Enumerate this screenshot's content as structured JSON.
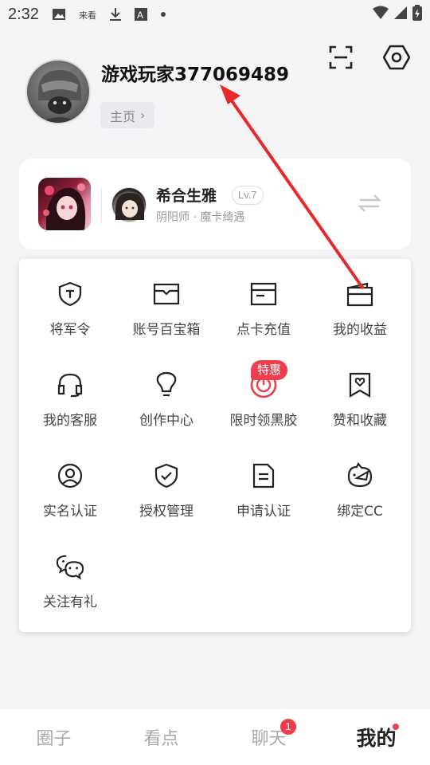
{
  "status_bar": {
    "time": "2:32",
    "icons": [
      "gallery-icon",
      "app-logo-icon",
      "download-icon",
      "font-icon",
      "dot-icon",
      "wifi-icon",
      "signal-icon",
      "battery-icon"
    ]
  },
  "header": {
    "scan_icon": "scan-icon",
    "settings_icon": "settings-hex-icon",
    "username": "游戏玩家377069489",
    "home_label": "主页",
    "home_chevron": "›"
  },
  "game_card": {
    "character_name": "希合生雅",
    "level": "Lv.7",
    "subtitle": "阴阳师 · 魔卡绮遇",
    "switch_icon": "swap-icon"
  },
  "menu": {
    "items": [
      {
        "label": "将军令",
        "icon": "shield-t-icon"
      },
      {
        "label": "账号百宝箱",
        "icon": "treasure-box-icon"
      },
      {
        "label": "点卡充值",
        "icon": "card-icon"
      },
      {
        "label": "我的收益",
        "icon": "wallet-icon"
      },
      {
        "label": "我的客服",
        "icon": "headset-icon"
      },
      {
        "label": "创作中心",
        "icon": "lightbulb-icon"
      },
      {
        "label": "限时领黑胶",
        "icon": "vinyl-icon"
      },
      {
        "label": "赞和收藏",
        "icon": "bookmark-heart-icon"
      },
      {
        "label": "实名认证",
        "icon": "user-circle-icon"
      },
      {
        "label": "授权管理",
        "icon": "shield-check-icon"
      },
      {
        "label": "申请认证",
        "icon": "document-icon"
      },
      {
        "label": "绑定CC",
        "icon": "cc-mascot-icon"
      },
      {
        "label": "关注有礼",
        "icon": "wechat-icon"
      }
    ],
    "promo_badge": "特惠"
  },
  "bottom_nav": {
    "tabs": [
      {
        "label": "圈子"
      },
      {
        "label": "看点"
      },
      {
        "label": "聊天"
      },
      {
        "label": "我的"
      }
    ],
    "chat_badge": "1"
  },
  "colors": {
    "accent_red": "#ef3d4c",
    "background": "#f4f4f6",
    "annotation_arrow": "#e8282b"
  }
}
